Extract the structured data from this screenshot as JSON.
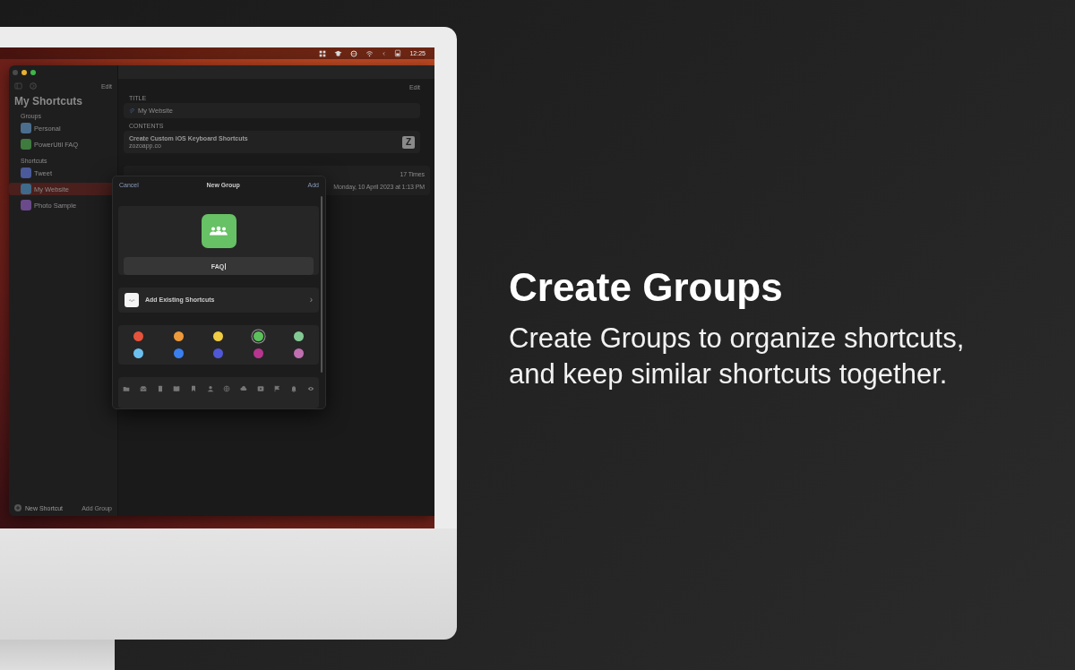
{
  "menu_bar": {
    "clock": "12:25"
  },
  "window": {
    "sidebar": {
      "title": "My Shortcuts",
      "edit": "Edit",
      "sections": [
        {
          "label": "Groups",
          "items": [
            {
              "label": "Personal",
              "color": "#4b6e8e",
              "selected": false
            },
            {
              "label": "PowerUtil FAQ",
              "color": "#3f7a3f",
              "selected": false
            }
          ]
        },
        {
          "label": "Shortcuts",
          "items": [
            {
              "label": "Tweet",
              "color": "#4a5a9a",
              "selected": false
            },
            {
              "label": "My Website",
              "color": "#3f6a8a",
              "selected": true
            },
            {
              "label": "Photo Sample",
              "color": "#6a4a8a",
              "selected": false
            }
          ]
        }
      ],
      "footer": {
        "new_shortcut": "New Shortcut",
        "add_group": "Add Group"
      }
    },
    "detail": {
      "edit": "Edit",
      "title_label": "TITLE",
      "title_value": "My Website",
      "contents_label": "CONTENTS",
      "content_title": "Create Custom iOS Keyboard Shortcuts",
      "content_subtitle": "zozoapp.co",
      "key": "Z",
      "usage_count": "17 Times",
      "last_used": "Monday, 10 April 2023 at 1:13 PM"
    }
  },
  "dialog": {
    "cancel": "Cancel",
    "title": "New Group",
    "add": "Add",
    "name_value": "FAQ",
    "add_existing": "Add Existing Shortcuts",
    "chevron": "›",
    "colors": [
      {
        "color": "#e5533c",
        "selected": false
      },
      {
        "color": "#ec9a3c",
        "selected": false
      },
      {
        "color": "#efcc44",
        "selected": false
      },
      {
        "color": "#5cc05c",
        "selected": true
      },
      {
        "color": "#84c994",
        "selected": false
      },
      {
        "color": "#6cc0f0",
        "selected": false
      },
      {
        "color": "#3a7ff0",
        "selected": false
      },
      {
        "color": "#5058d8",
        "selected": false
      },
      {
        "color": "#b8358f",
        "selected": false
      },
      {
        "color": "#c06fb0",
        "selected": false
      }
    ]
  },
  "headline": "Create Groups",
  "tagline": "Create Groups to organize shortcuts, and keep similar shortcuts together."
}
